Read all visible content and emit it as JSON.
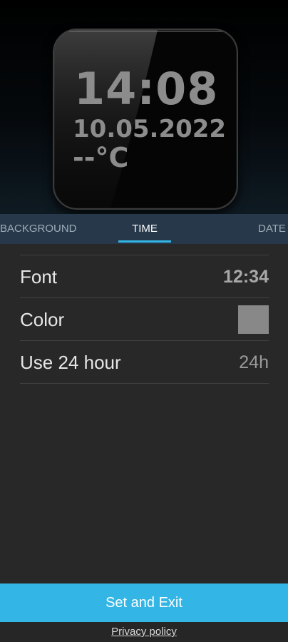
{
  "widget_preview": {
    "time": "14:08",
    "date": "10.05.2022",
    "temperature": "--°C",
    "text_color": "#8c8c8c"
  },
  "tabs": [
    {
      "label": "BACKGROUND",
      "selected": false
    },
    {
      "label": "TIME",
      "selected": true
    },
    {
      "label": "DATE",
      "selected": false
    }
  ],
  "settings": {
    "font": {
      "label": "Font",
      "value": "12:34"
    },
    "color": {
      "label": "Color",
      "swatch_color": "#888888"
    },
    "use_24_hour": {
      "label": "Use 24 hour",
      "value": "24h"
    }
  },
  "actions": {
    "set_and_exit": "Set and Exit",
    "privacy_policy": "Privacy policy"
  },
  "colors": {
    "accent": "#33b5e5",
    "tab_bar": "#263849",
    "background": "#282828"
  }
}
